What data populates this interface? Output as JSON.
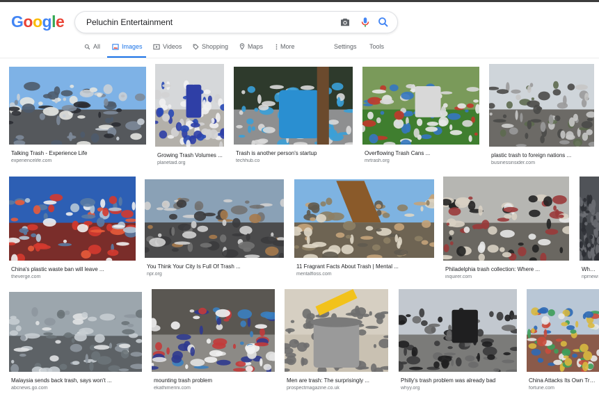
{
  "logo": [
    "G",
    "o",
    "o",
    "g",
    "l",
    "e"
  ],
  "colors": {
    "blue": "#4285f4",
    "red": "#ea4335",
    "yellow": "#fbbc05",
    "green": "#34a853",
    "link": "#1a73e8",
    "gray": "#5f6368"
  },
  "search": {
    "value": "Peluchin Entertainment"
  },
  "tabs": [
    {
      "label": "All",
      "icon": "search-icon"
    },
    {
      "label": "Images",
      "icon": "image-icon"
    },
    {
      "label": "Videos",
      "icon": "video-icon"
    },
    {
      "label": "Shopping",
      "icon": "tag-icon"
    },
    {
      "label": "Maps",
      "icon": "map-pin-icon"
    },
    {
      "label": "More",
      "icon": "more-icon"
    }
  ],
  "tools": {
    "settings": "Settings",
    "tools": "Tools"
  },
  "results": [
    {
      "caption": "Talking Trash - Experience Life",
      "source": "experiencelife.com"
    },
    {
      "caption": "Growing Trash Volumes ...",
      "source": "planetaid.org"
    },
    {
      "caption": "Trash is another person's startup",
      "source": "techhub.co"
    },
    {
      "caption": "Overflowing Trash Cans ...",
      "source": "mrtrash.org"
    },
    {
      "caption": "plastic trash to foreign nations ...",
      "source": "businessinsider.com"
    },
    {
      "caption": "China's plastic waste ban will leave ...",
      "source": "theverge.com"
    },
    {
      "caption": "You Think Your City Is Full Of Trash ...",
      "source": "npr.org"
    },
    {
      "caption": "11 Fragrant Facts About Trash | Mental ...",
      "source": "mentalfloss.com"
    },
    {
      "caption": "Philadelphia trash collection: Where ...",
      "source": "inquirer.com"
    },
    {
      "caption": "When M...",
      "source": "nprnews..."
    },
    {
      "caption": "Malaysia sends back trash, says won't ...",
      "source": "abcnews.go.com"
    },
    {
      "caption": "mounting trash problem",
      "source": "ekathimerini.com"
    },
    {
      "caption": "Men are trash: The surprisingly ...",
      "source": "prospectmagazine.co.uk"
    },
    {
      "caption": "Philly's trash problem was already bad",
      "source": "whyy.org"
    },
    {
      "caption": "China Attacks Its Own Trash ...",
      "source": "fortune.com"
    }
  ]
}
